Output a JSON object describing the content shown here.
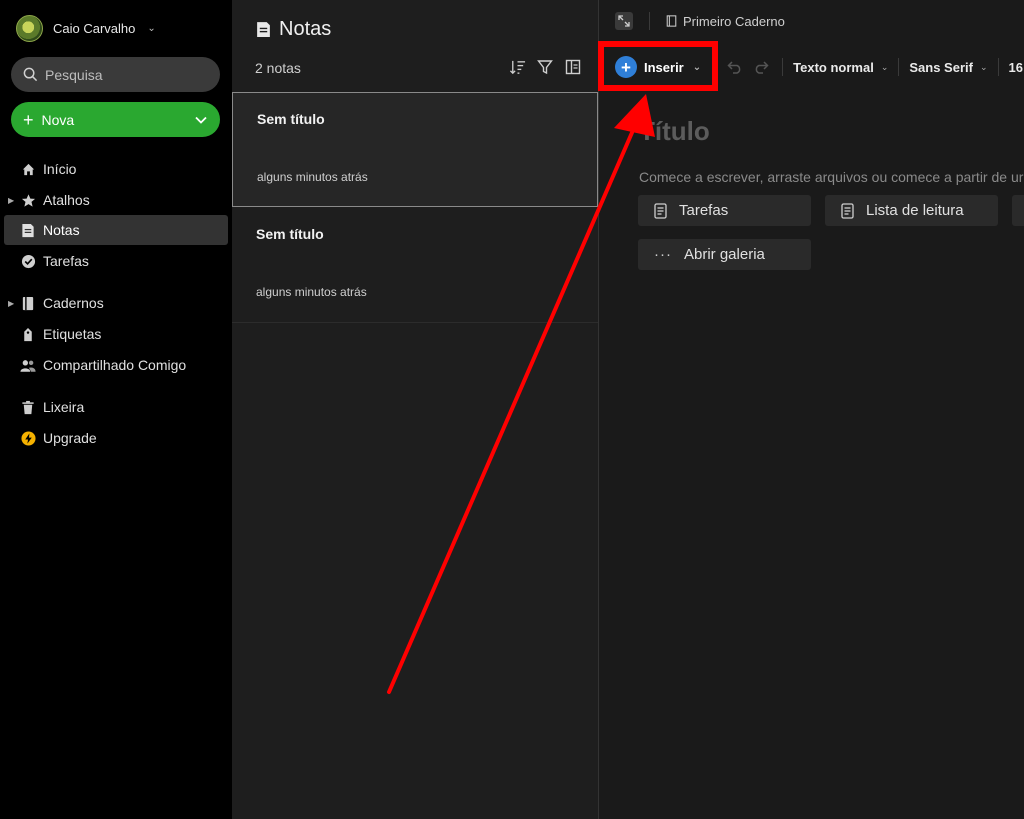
{
  "account": {
    "name": "Caio Carvalho"
  },
  "search": {
    "placeholder": "Pesquisa"
  },
  "new_button": {
    "label": "Nova"
  },
  "sidebar": {
    "items": [
      {
        "label": "Início",
        "icon": "home-icon"
      },
      {
        "label": "Atalhos",
        "icon": "star-icon"
      },
      {
        "label": "Notas",
        "icon": "note-icon"
      },
      {
        "label": "Tarefas",
        "icon": "check-circle-icon"
      },
      {
        "label": "Cadernos",
        "icon": "notebook-icon"
      },
      {
        "label": "Etiquetas",
        "icon": "tag-icon"
      },
      {
        "label": "Compartilhado Comigo",
        "icon": "people-icon"
      },
      {
        "label": "Lixeira",
        "icon": "trash-icon"
      },
      {
        "label": "Upgrade",
        "icon": "lightning-icon"
      }
    ]
  },
  "notelist": {
    "title": "Notas",
    "count": "2 notas",
    "notes": [
      {
        "title": "Sem título",
        "time": "alguns minutos atrás"
      },
      {
        "title": "Sem título",
        "time": "alguns minutos atrás"
      }
    ]
  },
  "editor": {
    "notebook": "Primeiro Caderno",
    "toolbar": {
      "insert": "Inserir",
      "style": "Texto normal",
      "font": "Sans Serif",
      "size": "16"
    },
    "title_placeholder": "Título",
    "hint": "Comece a escrever, arraste arquivos ou comece a partir de ur",
    "templates": [
      {
        "label": "Tarefas",
        "icon": "document-icon"
      },
      {
        "label": "Lista de leitura",
        "icon": "document-icon"
      },
      {
        "label": "Abrir galeria",
        "icon": "more-icon"
      }
    ]
  },
  "colors": {
    "accent_green": "#2aa830",
    "insert_blue": "#2f7fd8",
    "annotation_red": "#ff0000"
  }
}
